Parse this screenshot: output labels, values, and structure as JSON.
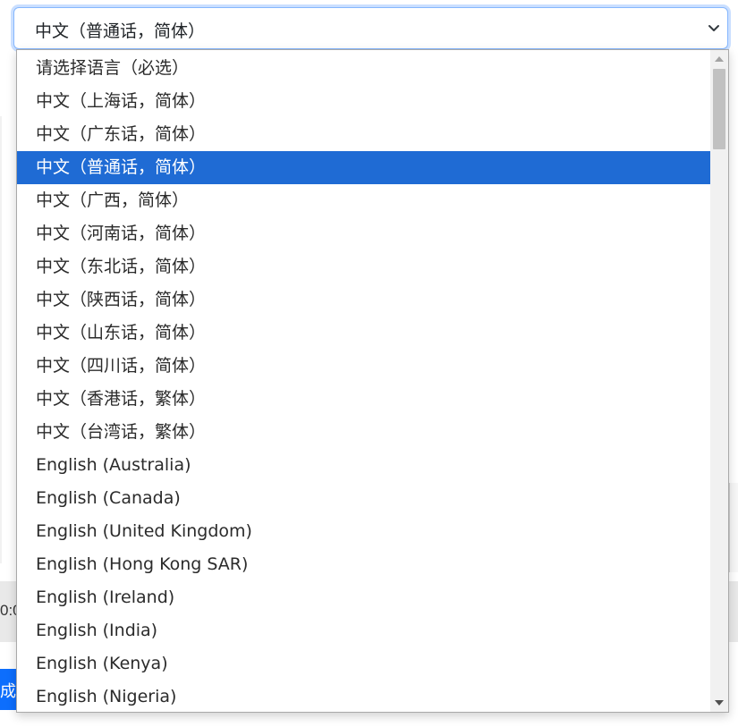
{
  "background": {
    "time_fragment": "0:0",
    "button_fragment": "成"
  },
  "select": {
    "value": "中文（普通话，简体）"
  },
  "dropdown": {
    "options": [
      {
        "label": "请选择语言（必选）",
        "selected": false
      },
      {
        "label": "中文（上海话，简体）",
        "selected": false
      },
      {
        "label": "中文（广东话，简体）",
        "selected": false
      },
      {
        "label": "中文（普通话，简体）",
        "selected": true
      },
      {
        "label": "中文（广西，简体）",
        "selected": false
      },
      {
        "label": "中文（河南话，简体）",
        "selected": false
      },
      {
        "label": "中文（东北话，简体）",
        "selected": false
      },
      {
        "label": "中文（陕西话，简体）",
        "selected": false
      },
      {
        "label": "中文（山东话，简体）",
        "selected": false
      },
      {
        "label": "中文（四川话，简体）",
        "selected": false
      },
      {
        "label": "中文（香港话，繁体）",
        "selected": false
      },
      {
        "label": "中文（台湾话，繁体）",
        "selected": false
      },
      {
        "label": "English (Australia)",
        "selected": false
      },
      {
        "label": "English (Canada)",
        "selected": false
      },
      {
        "label": "English (United Kingdom)",
        "selected": false
      },
      {
        "label": "English (Hong Kong SAR)",
        "selected": false
      },
      {
        "label": "English (Ireland)",
        "selected": false
      },
      {
        "label": "English (India)",
        "selected": false
      },
      {
        "label": "English (Kenya)",
        "selected": false
      },
      {
        "label": "English (Nigeria)",
        "selected": false
      }
    ]
  },
  "colors": {
    "selected_bg": "#1f6bd4",
    "focus_border": "#86b7fe",
    "primary_button": "#0d6efd"
  },
  "icons": {
    "select_chevron": "chevron-down-icon",
    "scroll_up": "scroll-up-arrow-icon",
    "scroll_down": "scroll-down-arrow-icon"
  }
}
